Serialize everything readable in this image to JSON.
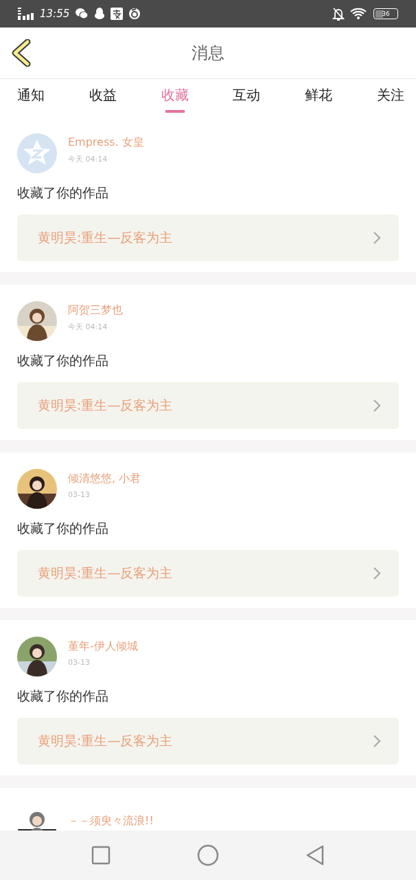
{
  "status_bar": {
    "time": "13:55",
    "battery": "36"
  },
  "header": {
    "title": "消息"
  },
  "tabs": [
    {
      "label": "通知",
      "selected": false
    },
    {
      "label": "收益",
      "selected": false
    },
    {
      "label": "收藏",
      "selected": true
    },
    {
      "label": "互动",
      "selected": false
    },
    {
      "label": "鲜花",
      "selected": false
    },
    {
      "label": "关注",
      "selected": false
    }
  ],
  "messages": [
    {
      "kind": "default_avatar",
      "user": "Empress. 女皇",
      "time": "今天 04:14",
      "text": "收藏了你的作品",
      "work": "黄明昊:重生—反客为主"
    },
    {
      "kind": "photo_avatar",
      "user": "阿贺三梦也",
      "time": "今天 04:14",
      "text": "收藏了你的作品",
      "work": "黄明昊:重生—反客为主"
    },
    {
      "kind": "photo_avatar",
      "user": "倾清悠悠, 小君",
      "time": "03-13",
      "text": "收藏了你的作品",
      "work": "黄明昊:重生—反客为主"
    },
    {
      "kind": "photo_avatar",
      "user": "堇年-伊人倾城",
      "time": "03-13",
      "text": "收藏了你的作品",
      "work": "黄明昊:重生—反客为主"
    },
    {
      "kind": "photo_avatar",
      "user": "－－须臾々流浪!!"
    }
  ]
}
